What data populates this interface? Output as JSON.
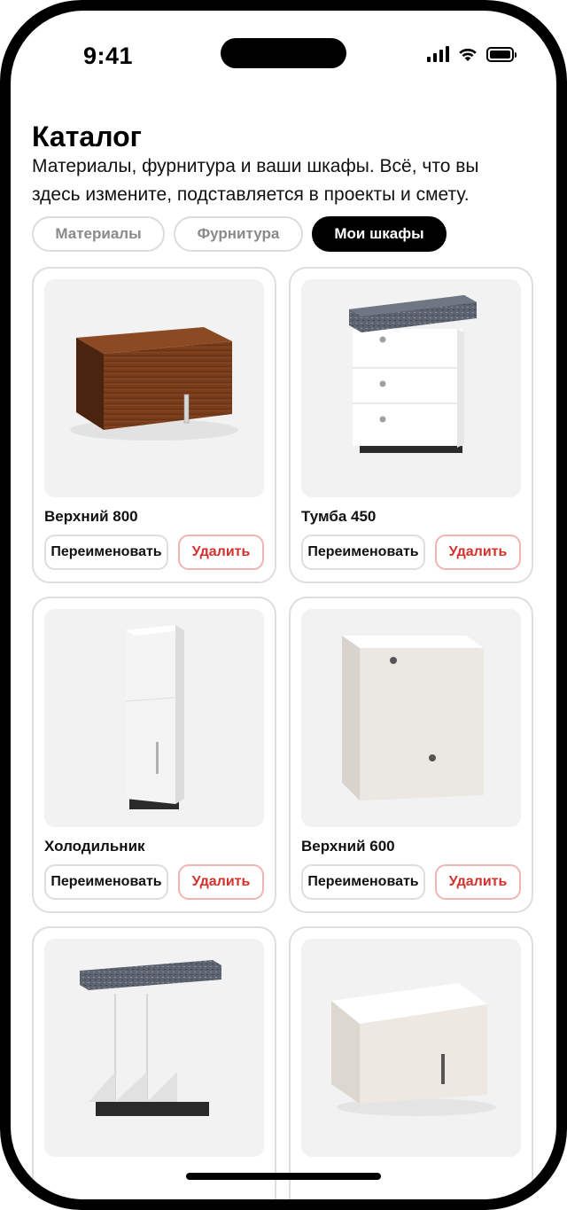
{
  "status_bar": {
    "time": "9:41"
  },
  "header": {
    "title": "Каталог",
    "subtitle": "Материалы, фурнитура и ваши шкафы. Всё, что вы здесь измените, подставляется в проекты и смету."
  },
  "tabs": [
    {
      "label": "Материалы",
      "active": false
    },
    {
      "label": "Фурнитура",
      "active": false
    },
    {
      "label": "Мои шкафы",
      "active": true
    }
  ],
  "actions": {
    "rename_label": "Переименовать",
    "delete_label": "Удалить"
  },
  "cabinets": [
    {
      "name": "Верхний 800"
    },
    {
      "name": "Тумба 450"
    },
    {
      "name": "Холодильник"
    },
    {
      "name": "Верхний 600"
    },
    {
      "name": ""
    },
    {
      "name": ""
    }
  ],
  "colors": {
    "accent_delete": "#d3312b",
    "tab_active_bg": "#000000"
  }
}
